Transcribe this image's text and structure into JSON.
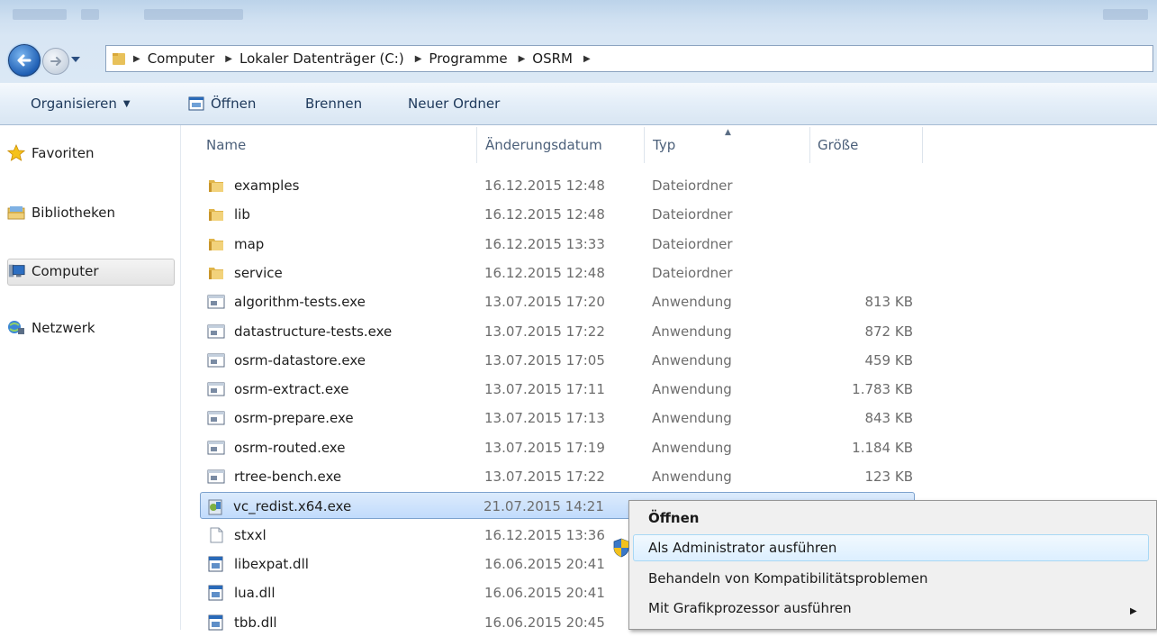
{
  "breadcrumb": [
    "Computer",
    "Lokaler Datenträger (C:)",
    "Programme",
    "OSRM"
  ],
  "toolbar": {
    "organize_label": "Organisieren",
    "open_label": "Öffnen",
    "burn_label": "Brennen",
    "new_folder_label": "Neuer Ordner"
  },
  "nav": {
    "favorites": "Favoriten",
    "libraries": "Bibliotheken",
    "computer": "Computer",
    "network": "Netzwerk",
    "selected": "Computer"
  },
  "columns": {
    "name": "Name",
    "date": "Änderungsdatum",
    "type": "Typ",
    "size": "Größe",
    "sorted_by": "Typ"
  },
  "files": [
    {
      "name": "examples",
      "date": "16.12.2015 12:48",
      "type": "Dateiordner",
      "size": "",
      "icon": "folder-icon"
    },
    {
      "name": "lib",
      "date": "16.12.2015 12:48",
      "type": "Dateiordner",
      "size": "",
      "icon": "folder-icon"
    },
    {
      "name": "map",
      "date": "16.12.2015 13:33",
      "type": "Dateiordner",
      "size": "",
      "icon": "folder-icon"
    },
    {
      "name": "service",
      "date": "16.12.2015 12:48",
      "type": "Dateiordner",
      "size": "",
      "icon": "folder-icon"
    },
    {
      "name": "algorithm-tests.exe",
      "date": "13.07.2015 17:20",
      "type": "Anwendung",
      "size": "813 KB",
      "icon": "exe-icon"
    },
    {
      "name": "datastructure-tests.exe",
      "date": "13.07.2015 17:22",
      "type": "Anwendung",
      "size": "872 KB",
      "icon": "exe-icon"
    },
    {
      "name": "osrm-datastore.exe",
      "date": "13.07.2015 17:05",
      "type": "Anwendung",
      "size": "459 KB",
      "icon": "exe-icon"
    },
    {
      "name": "osrm-extract.exe",
      "date": "13.07.2015 17:11",
      "type": "Anwendung",
      "size": "1.783 KB",
      "icon": "exe-icon"
    },
    {
      "name": "osrm-prepare.exe",
      "date": "13.07.2015 17:13",
      "type": "Anwendung",
      "size": "843 KB",
      "icon": "exe-icon"
    },
    {
      "name": "osrm-routed.exe",
      "date": "13.07.2015 17:19",
      "type": "Anwendung",
      "size": "1.184 KB",
      "icon": "exe-icon"
    },
    {
      "name": "rtree-bench.exe",
      "date": "13.07.2015 17:22",
      "type": "Anwendung",
      "size": "123 KB",
      "icon": "exe-icon"
    },
    {
      "name": "vc_redist.x64.exe",
      "date": "21.07.2015 14:21",
      "type": "",
      "size": "",
      "icon": "installer-icon",
      "selected": true
    },
    {
      "name": "stxxl",
      "date": "16.12.2015 13:36",
      "type": "",
      "size": "",
      "icon": "blank-file-icon"
    },
    {
      "name": "libexpat.dll",
      "date": "16.06.2015 20:41",
      "type": "",
      "size": "",
      "icon": "dll-icon"
    },
    {
      "name": "lua.dll",
      "date": "16.06.2015 20:41",
      "type": "",
      "size": "",
      "icon": "dll-icon"
    },
    {
      "name": "tbb.dll",
      "date": "16.06.2015 20:45",
      "type": "",
      "size": "",
      "icon": "dll-icon"
    }
  ],
  "context_menu": {
    "open": "Öffnen",
    "run_as_admin": "Als Administrator ausführen",
    "troubleshoot": "Behandeln von Kompatibilitätsproblemen",
    "run_with_gpu": "Mit Grafikprozessor ausführen"
  },
  "colors": {
    "accent": "#1f5fb4",
    "selection": "#c1dbfc",
    "command_text": "#1e395b"
  }
}
